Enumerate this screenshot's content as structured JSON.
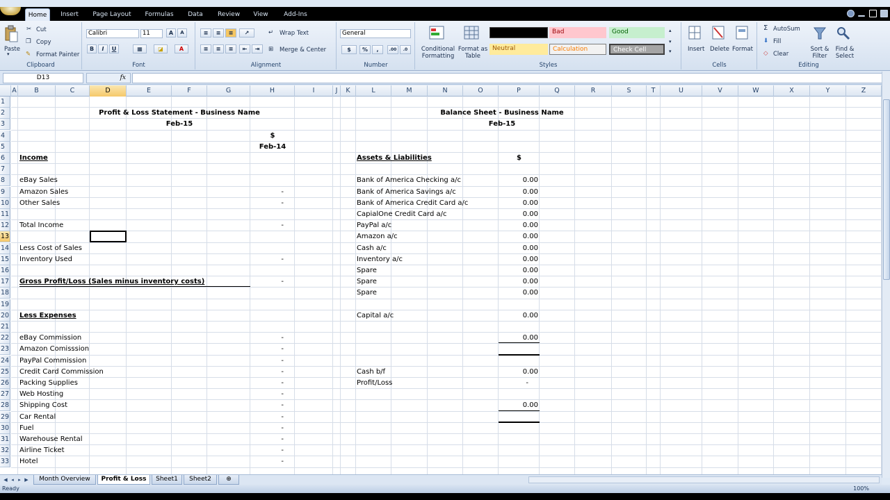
{
  "ribbon_tabs": [
    "Home",
    "Insert",
    "Page Layout",
    "Formulas",
    "Data",
    "Review",
    "View",
    "Add-Ins"
  ],
  "active_tab": "Home",
  "clipboard": {
    "paste": "Paste",
    "cut": "Cut",
    "copy": "Copy",
    "format_painter": "Format Painter",
    "label": "Clipboard"
  },
  "font": {
    "name": "Calibri",
    "size": "11",
    "label": "Font",
    "bold": "B",
    "italic": "I",
    "underline": "U"
  },
  "alignment": {
    "wrap": "Wrap Text",
    "merge": "Merge & Center",
    "label": "Alignment"
  },
  "number": {
    "format": "General",
    "label": "Number",
    "currency": "$",
    "percent": "%",
    "comma": ","
  },
  "styles": {
    "conditional": "Conditional Formatting",
    "format_table": "Format as Table",
    "normal": "",
    "bad": "Bad",
    "good": "Good",
    "neutral": "Neutral",
    "calculation": "Calculation",
    "check_cell": "Check Cell",
    "label": "Styles"
  },
  "cells": {
    "insert": "Insert",
    "delete": "Delete",
    "format": "Format",
    "label": "Cells"
  },
  "editing": {
    "autosum": "AutoSum",
    "fill": "Fill",
    "clear": "Clear",
    "sort": "Sort & Filter",
    "find": "Find & Select",
    "label": "Editing"
  },
  "formula_bar": {
    "name_box": "D13",
    "fx": "fx",
    "value": ""
  },
  "columns": [
    "A",
    "B",
    "C",
    "D",
    "E",
    "F",
    "G",
    "H",
    "I",
    "J",
    "K",
    "L",
    "M",
    "N",
    "O",
    "P",
    "Q",
    "R",
    "S",
    "T",
    "U",
    "V",
    "W",
    "X",
    "Y",
    "Z"
  ],
  "rows": [
    "1",
    "2",
    "3",
    "4",
    "5",
    "6",
    "7",
    "8",
    "9",
    "10",
    "11",
    "12",
    "13",
    "14",
    "15",
    "16",
    "17",
    "18",
    "19",
    "20",
    "21",
    "22",
    "23",
    "24",
    "25",
    "26",
    "27",
    "28",
    "29",
    "30",
    "31",
    "32",
    "33"
  ],
  "pl": {
    "title": "Profit & Loss Statement - Business Name",
    "period": "Feb-15",
    "currency": "$",
    "col_date": "Feb-14",
    "income": "Income",
    "ebay_sales": "eBay Sales",
    "amazon_sales": "Amazon Sales",
    "other_sales": "Other Sales",
    "total_income": "Total Income",
    "less_cost": "Less Cost of Sales",
    "inventory_used": "Inventory Used",
    "gross": "Gross Profit/Loss (Sales minus inventory costs)",
    "less_expenses": "Less Expenses",
    "expenses": [
      "eBay Commission",
      "Amazon Comisssion",
      "PayPal Commission",
      "Credit Card Commission",
      "Packing Supplies",
      "Web Hosting",
      "Shipping Cost",
      "Car Rental",
      "Fuel",
      "Warehouse Rental",
      "Airline Ticket",
      "Hotel"
    ],
    "dash": "-"
  },
  "bs": {
    "title": "Balance Sheet - Business Name",
    "period": "Feb-15",
    "assets": "Assets & Liabilities",
    "currency": "$",
    "items": [
      "Bank of America Checking a/c",
      "Bank of America Savings a/c",
      "Bank of America Credit Card a/c",
      "CapialOne Credit Card a/c",
      "PayPal a/c",
      "Amazon a/c",
      "Cash a/c",
      "Inventory a/c",
      "Spare",
      "Spare",
      "Spare"
    ],
    "zero": "0.00",
    "capital": "Capital a/c",
    "cash_bf": "Cash b/f",
    "profit_loss": "Profit/Loss",
    "dash": "-"
  },
  "sheets": [
    "Month Overview",
    "Profit & Loss",
    "Sheet1",
    "Sheet2"
  ],
  "active_sheet": "Profit & Loss",
  "status": {
    "ready": "Ready",
    "zoom": "100%"
  }
}
